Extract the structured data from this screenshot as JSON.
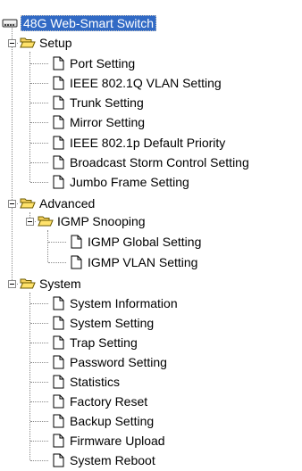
{
  "tree": {
    "root": {
      "label": "48G Web-Smart Switch",
      "icon": "switch-icon"
    },
    "setup": {
      "label": "Setup",
      "items": [
        "Port Setting",
        "IEEE 802.1Q VLAN Setting",
        "Trunk Setting",
        "Mirror Setting",
        "IEEE 802.1p Default Priority",
        "Broadcast Storm Control Setting",
        "Jumbo Frame Setting"
      ]
    },
    "advanced": {
      "label": "Advanced",
      "igmp": {
        "label": "IGMP Snooping",
        "items": [
          "IGMP Global Setting",
          "IGMP VLAN Setting"
        ]
      }
    },
    "system": {
      "label": "System",
      "items": [
        "System Information",
        "System Setting",
        "Trap Setting",
        "Password Setting",
        "Statistics",
        "Factory Reset",
        "Backup Setting",
        "Firmware Upload",
        "System Reboot"
      ]
    }
  },
  "colors": {
    "selection": "#316ac5",
    "folder": "#ffe26b",
    "connector": "#8a8a8a"
  }
}
